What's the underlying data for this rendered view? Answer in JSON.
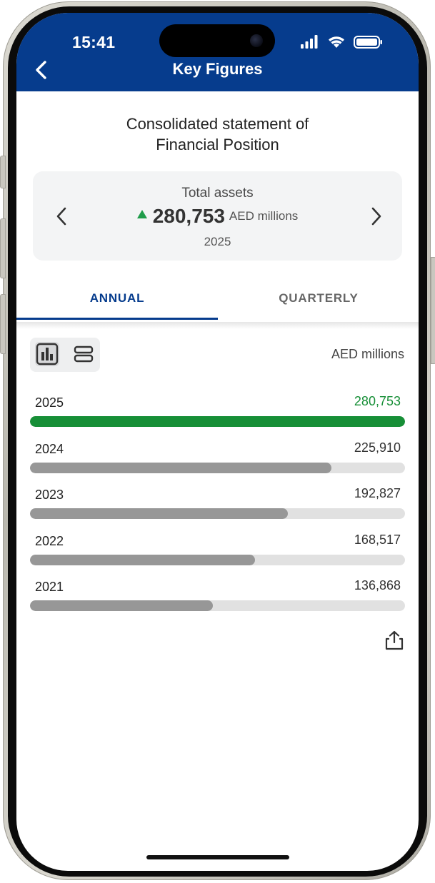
{
  "status_bar": {
    "time": "15:41"
  },
  "header": {
    "title": "Key Figures"
  },
  "statement": {
    "title_line1": "Consolidated statement of",
    "title_line2": "Financial Position"
  },
  "summary_card": {
    "label": "Total assets",
    "value": "280,753",
    "unit": "AED millions",
    "year": "2025",
    "trend": "up"
  },
  "tabs": [
    {
      "label": "ANNUAL",
      "active": true
    },
    {
      "label": "QUARTERLY",
      "active": false
    }
  ],
  "unit_label": "AED millions",
  "colors": {
    "header": "#063c8d",
    "current_bar": "#178f37",
    "past_bar": "#979797",
    "track": "#e1e1e1",
    "trend_up": "#1f9c4a"
  },
  "chart_data": {
    "type": "bar",
    "orientation": "horizontal",
    "categories": [
      "2025",
      "2024",
      "2023",
      "2022",
      "2021"
    ],
    "values": [
      280753,
      225910,
      192827,
      168517,
      136868
    ],
    "value_labels": [
      "280,753",
      "225,910",
      "192,827",
      "168,517",
      "136,868"
    ],
    "unit": "AED millions",
    "highlight": "2025"
  }
}
